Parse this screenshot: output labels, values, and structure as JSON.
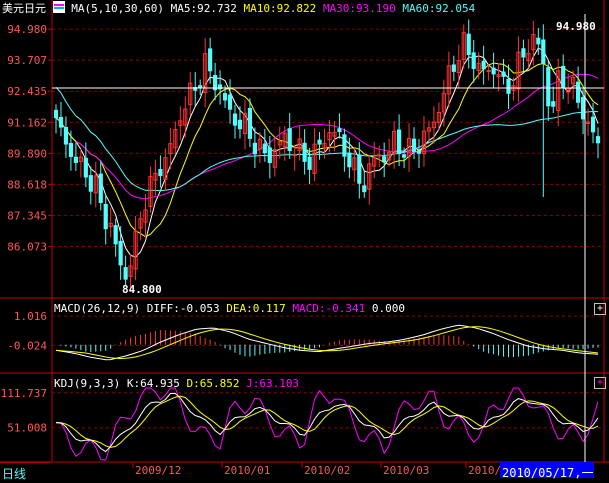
{
  "header": {
    "symbol": "美元日元",
    "ma_label": "MA(5,10,30,60)",
    "ma5": "MA5:92.732",
    "ma10": "MA10:92.822",
    "ma30": "MA30:93.190",
    "ma60": "MA60:92.054",
    "macd_label": "MACD(26,12,9)",
    "diff": "DIFF:-0.053",
    "dea": "DEA:0.117",
    "macd": "MACD:-0.341",
    "macd_zero": "0.000",
    "kdj_label": "KDJ(9,3,3)",
    "k": "K:64.935",
    "d": "D:65.852",
    "j": "J:63.103"
  },
  "colors": {
    "bg": "#000000",
    "grid": "#8b0000",
    "axis": "#c00000",
    "up": "#ff3232",
    "down": "#54fcfc",
    "ma5": "#ffffff",
    "ma10": "#ffff00",
    "ma30": "#ff00ff",
    "ma60": "#00e000",
    "ma60_header": "#54fcfc",
    "axis_text": "#ff5555"
  },
  "footer": {
    "period": "日线",
    "cursor_date": "2010/05/17,一"
  },
  "chart_data": {
    "type": "candlestick",
    "price_axis_ticks": [
      "94.980",
      "93.707",
      "92.435",
      "91.162",
      "89.890",
      "88.618",
      "87.345",
      "86.073"
    ],
    "price_range": [
      84.0,
      95.6
    ],
    "high_label": "94.980",
    "low_label": "84.800",
    "macd_ticks": [
      "1.016",
      "-0.024"
    ],
    "kdj_ticks": [
      "111.737",
      "51.008"
    ],
    "x_axis": [
      "2009/12",
      "2010/01",
      "2010/02",
      "2010/03",
      "2010/0"
    ],
    "price_key_closes": [
      91.1,
      90.6,
      89.8,
      89.4,
      89.0,
      88.5,
      87.5,
      86.8,
      85.5,
      84.8,
      86.0,
      87.8,
      88.4,
      89.3,
      89.6,
      90.6,
      91.6,
      92.2,
      92.8,
      93.5,
      93.0,
      92.4,
      91.6,
      91.2,
      91.0,
      90.5,
      90.0,
      89.7,
      90.1,
      90.5,
      90.2,
      89.9,
      89.6,
      89.9,
      90.4,
      90.9,
      90.5,
      89.9,
      89.1,
      88.6,
      89.2,
      90.0,
      89.6,
      90.4,
      90.1,
      89.9,
      90.2,
      90.6,
      91.1,
      92.0,
      93.0,
      93.9,
      94.3,
      93.8,
      93.3,
      93.2,
      93.5,
      92.5,
      92.8,
      93.6,
      94.2,
      94.8,
      93.5,
      91.5,
      92.8,
      93.0,
      92.4,
      91.6,
      91.0,
      90.1
    ],
    "macd_key_values": [
      -0.2,
      -0.3,
      -0.45,
      -0.55,
      -0.4,
      -0.2,
      0.1,
      0.35,
      0.55,
      0.6,
      0.45,
      0.2,
      0.05,
      -0.1,
      -0.2,
      -0.25,
      -0.15,
      -0.05,
      0.05,
      0.1,
      0.2,
      0.35,
      0.55,
      0.7,
      0.6,
      0.4,
      0.15,
      -0.05,
      -0.15,
      -0.2,
      -0.3,
      -0.34
    ],
    "kdj_key_values": [
      60,
      40,
      25,
      15,
      35,
      70,
      95,
      110,
      90,
      60,
      45,
      65,
      85,
      75,
      55,
      40,
      70,
      95,
      80,
      55,
      35,
      55,
      80,
      90,
      75,
      60,
      50,
      75,
      95,
      100,
      80,
      60,
      45,
      65
    ]
  }
}
